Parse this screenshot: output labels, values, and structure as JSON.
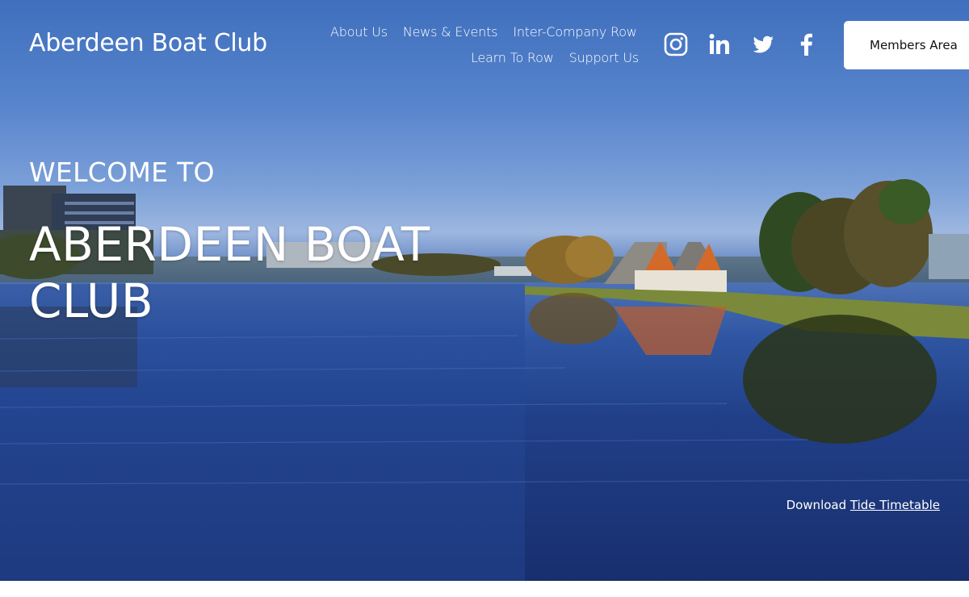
{
  "header": {
    "site_title": "Aberdeen Boat Club",
    "nav_row1": [
      "About Us",
      "News & Events",
      "Inter-Company Row"
    ],
    "nav_row2": [
      "Learn To Row",
      "Support Us"
    ],
    "social_icons": [
      "instagram-icon",
      "linkedin-icon",
      "twitter-icon",
      "facebook-icon"
    ],
    "members_button": "Members Area"
  },
  "hero": {
    "welcome": "WELCOME TO",
    "headline": "ABERDEEN BOAT CLUB",
    "tide_prefix": "Download",
    "tide_link": "Tide Timetable"
  },
  "colors": {
    "sky": "#5784cc",
    "water": "#213f88",
    "button_bg": "#ffffff",
    "text": "#ffffff"
  }
}
